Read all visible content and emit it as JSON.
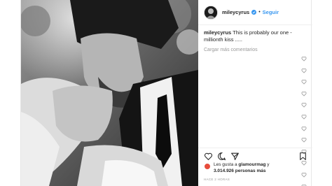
{
  "post": {
    "username": "mileycyrus",
    "follow_label": "Seguir",
    "separator": "•",
    "caption_user": "mileycyrus",
    "caption_text": "This is probably our one - millionth kiss .....",
    "load_more": "Cargar más comentarios",
    "likes_prefix": "Les gusta a",
    "likes_user": "glamourmag",
    "likes_middle": "y",
    "likes_count": "3.014.926",
    "likes_suffix": "personas más",
    "timestamp": "HACE 2 HORAS"
  },
  "colors": {
    "link_blue": "#3897f0",
    "verified_blue": "#3897f0",
    "text": "#262626",
    "muted": "#999999"
  },
  "icons": [
    "verified-badge-icon",
    "heart-icon",
    "comment-icon",
    "share-icon",
    "bookmark-icon",
    "heart-mini-icon"
  ]
}
